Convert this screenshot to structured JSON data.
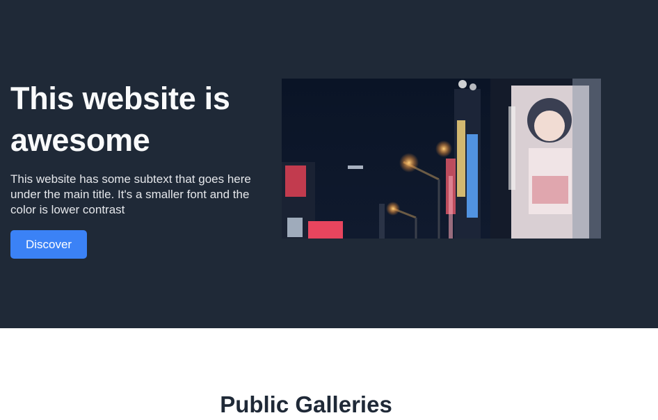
{
  "hero": {
    "title": "This website is awesome",
    "subtext": "This website has some subtext that goes here under the main title. It's a smaller font and the color is lower contrast",
    "cta_label": "Discover",
    "image_alt": "Night city street with neon signs",
    "colors": {
      "background": "#1f2937",
      "title": "#f9fafb",
      "subtext": "#e5e7eb",
      "button": "#3b82f6"
    }
  },
  "gallery": {
    "title": "Public Galleries"
  }
}
